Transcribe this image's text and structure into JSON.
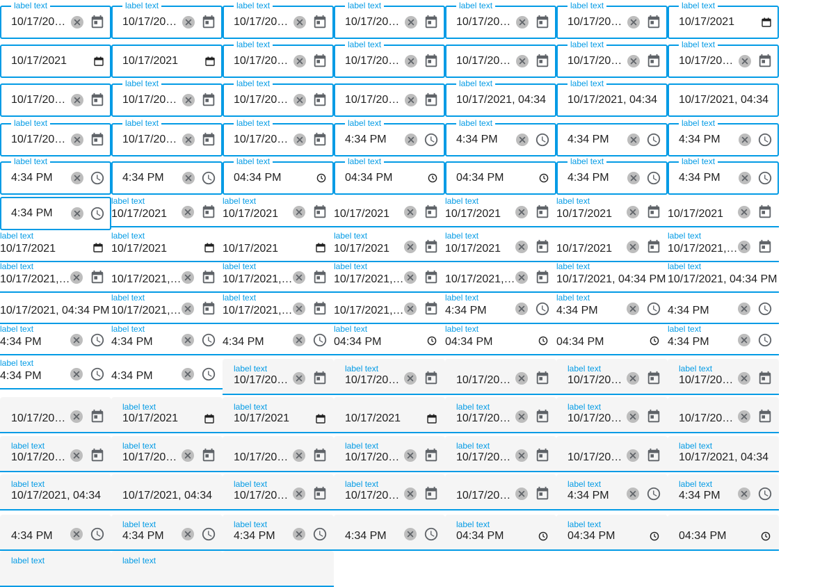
{
  "rows": [
    [
      {
        "v": "o",
        "label": "label text",
        "value": "10/17/20…",
        "icon": "calendar-icon",
        "clear": true
      },
      {
        "v": "o",
        "label": "label text",
        "value": "10/17/20…",
        "icon": "calendar-icon",
        "clear": true
      },
      {
        "v": "o",
        "label": "label text",
        "value": "10/17/20…",
        "icon": "calendar-icon",
        "clear": true
      },
      {
        "v": "o",
        "label": "label text",
        "value": "10/17/20…",
        "icon": "calendar-icon",
        "clear": true
      },
      {
        "v": "o",
        "label": "label text",
        "value": "10/17/20…",
        "icon": "calendar-icon",
        "clear": true
      },
      {
        "v": "o",
        "label": "label text",
        "value": "10/17/20…",
        "icon": "calendar-icon",
        "clear": true
      },
      {
        "v": "o",
        "label": "label text",
        "value": "10/17/2021",
        "icon": "native-calendar-icon",
        "clear": false
      }
    ],
    [
      {
        "v": "o",
        "label": "",
        "value": "10/17/2021",
        "icon": "native-calendar-icon",
        "clear": false
      },
      {
        "v": "o",
        "label": "",
        "value": "10/17/2021",
        "icon": "native-calendar-icon",
        "clear": false
      },
      {
        "v": "o",
        "label": "label text",
        "value": "10/17/20…",
        "icon": "calendar-icon",
        "clear": true
      },
      {
        "v": "o",
        "label": "label text",
        "value": "10/17/20…",
        "icon": "calendar-icon",
        "clear": true
      },
      {
        "v": "o",
        "label": "",
        "value": "10/17/20…",
        "icon": "calendar-icon",
        "clear": true
      },
      {
        "v": "o",
        "label": "label text",
        "value": "10/17/20…",
        "icon": "calendar-icon",
        "clear": true
      },
      {
        "v": "o",
        "label": "label text",
        "value": "10/17/20…",
        "icon": "calendar-icon",
        "clear": true
      }
    ],
    [
      {
        "v": "o",
        "label": "",
        "value": "10/17/20…",
        "icon": "calendar-icon",
        "clear": true
      },
      {
        "v": "o",
        "label": "label text",
        "value": "10/17/20…",
        "icon": "calendar-icon",
        "clear": true
      },
      {
        "v": "o",
        "label": "label text",
        "value": "10/17/20…",
        "icon": "calendar-icon",
        "clear": true
      },
      {
        "v": "o",
        "label": "",
        "value": "10/17/20…",
        "icon": "calendar-icon",
        "clear": true
      },
      {
        "v": "o",
        "label": "label text",
        "value": "10/17/2021, 04:34",
        "icon": "none",
        "clear": false,
        "wide": true
      },
      {
        "v": "o",
        "label": "label text",
        "value": "10/17/2021, 04:34",
        "icon": "none",
        "clear": false,
        "wide": true
      },
      {
        "v": "o",
        "label": "",
        "value": "10/17/2021, 04:34",
        "icon": "none",
        "clear": false,
        "wide": true
      }
    ],
    [
      {
        "v": "o",
        "label": "label text",
        "value": "10/17/20…",
        "icon": "calendar-icon",
        "clear": true
      },
      {
        "v": "o",
        "label": "label text",
        "value": "10/17/20…",
        "icon": "calendar-icon",
        "clear": true
      },
      {
        "v": "o",
        "label": "label text",
        "value": "10/17/20…",
        "icon": "calendar-icon",
        "clear": true
      },
      {
        "v": "o",
        "label": "label text",
        "value": "4:34 PM",
        "icon": "clock-icon",
        "clear": true
      },
      {
        "v": "o",
        "label": "label text",
        "value": "4:34 PM",
        "icon": "clock-icon",
        "clear": true
      },
      {
        "v": "o",
        "label": "",
        "value": "4:34 PM",
        "icon": "clock-icon",
        "clear": true
      },
      {
        "v": "o",
        "label": "label text",
        "value": "4:34 PM",
        "icon": "clock-icon",
        "clear": true
      }
    ],
    [
      {
        "v": "o",
        "label": "label text",
        "value": "4:34 PM",
        "icon": "clock-icon",
        "clear": true
      },
      {
        "v": "o",
        "label": "",
        "value": "4:34 PM",
        "icon": "clock-icon",
        "clear": true
      },
      {
        "v": "o",
        "label": "label text",
        "value": "04:34 PM",
        "icon": "native-clock-icon",
        "clear": false
      },
      {
        "v": "o",
        "label": "label text",
        "value": "04:34 PM",
        "icon": "native-clock-icon",
        "clear": false
      },
      {
        "v": "o",
        "label": "",
        "value": "04:34 PM",
        "icon": "native-clock-icon",
        "clear": false
      },
      {
        "v": "o",
        "label": "label text",
        "value": "4:34 PM",
        "icon": "clock-icon",
        "clear": true
      },
      {
        "v": "o",
        "label": "label text",
        "value": "4:34 PM",
        "icon": "clock-icon",
        "clear": true
      }
    ],
    [
      {
        "v": "o",
        "label": "",
        "value": "4:34 PM",
        "icon": "clock-icon",
        "clear": true
      },
      {
        "v": "s",
        "label": "label text",
        "value": "10/17/2021",
        "icon": "calendar-icon",
        "clear": true
      },
      {
        "v": "s",
        "label": "label text",
        "value": "10/17/2021",
        "icon": "calendar-icon",
        "clear": true
      },
      {
        "v": "s",
        "label": "",
        "value": "10/17/2021",
        "icon": "calendar-icon",
        "clear": true
      },
      {
        "v": "s",
        "label": "label text",
        "value": "10/17/2021",
        "icon": "calendar-icon",
        "clear": true
      },
      {
        "v": "s",
        "label": "label text",
        "value": "10/17/2021",
        "icon": "calendar-icon",
        "clear": true
      },
      {
        "v": "s",
        "label": "",
        "value": "10/17/2021",
        "icon": "calendar-icon",
        "clear": true
      }
    ],
    [
      {
        "v": "s",
        "label": "label text",
        "value": "10/17/2021",
        "icon": "native-calendar-icon",
        "clear": false
      },
      {
        "v": "s",
        "label": "label text",
        "value": "10/17/2021",
        "icon": "native-calendar-icon",
        "clear": false
      },
      {
        "v": "s",
        "label": "",
        "value": "10/17/2021",
        "icon": "native-calendar-icon",
        "clear": false
      },
      {
        "v": "s",
        "label": "label text",
        "value": "10/17/2021",
        "icon": "calendar-icon",
        "clear": true
      },
      {
        "v": "s",
        "label": "label text",
        "value": "10/17/2021",
        "icon": "calendar-icon",
        "clear": true
      },
      {
        "v": "s",
        "label": "",
        "value": "10/17/2021",
        "icon": "calendar-icon",
        "clear": true
      },
      {
        "v": "s",
        "label": "label text",
        "value": "10/17/2021,…",
        "icon": "calendar-icon",
        "clear": true
      }
    ],
    [
      {
        "v": "s",
        "label": "label text",
        "value": "10/17/2021,…",
        "icon": "calendar-icon",
        "clear": true
      },
      {
        "v": "s",
        "label": "",
        "value": "10/17/2021,…",
        "icon": "calendar-icon",
        "clear": true
      },
      {
        "v": "s",
        "label": "label text",
        "value": "10/17/2021,…",
        "icon": "calendar-icon",
        "clear": true
      },
      {
        "v": "s",
        "label": "label text",
        "value": "10/17/2021,…",
        "icon": "calendar-icon",
        "clear": true
      },
      {
        "v": "s",
        "label": "",
        "value": "10/17/2021,…",
        "icon": "calendar-icon",
        "clear": true
      },
      {
        "v": "s",
        "label": "label text",
        "value": "10/17/2021, 04:34 PM",
        "icon": "none",
        "clear": false
      },
      {
        "v": "s",
        "label": "label text",
        "value": "10/17/2021, 04:34 PM",
        "icon": "none",
        "clear": false
      }
    ],
    [
      {
        "v": "s",
        "label": "",
        "value": "10/17/2021, 04:34 PM",
        "icon": "none",
        "clear": false
      },
      {
        "v": "s",
        "label": "label text",
        "value": "10/17/2021,…",
        "icon": "calendar-icon",
        "clear": true
      },
      {
        "v": "s",
        "label": "label text",
        "value": "10/17/2021,…",
        "icon": "calendar-icon",
        "clear": true
      },
      {
        "v": "s",
        "label": "",
        "value": "10/17/2021,…",
        "icon": "calendar-icon",
        "clear": true
      },
      {
        "v": "s",
        "label": "label text",
        "value": "4:34 PM",
        "icon": "clock-icon",
        "clear": true
      },
      {
        "v": "s",
        "label": "label text",
        "value": "4:34 PM",
        "icon": "clock-icon",
        "clear": true
      },
      {
        "v": "s",
        "label": "",
        "value": "4:34 PM",
        "icon": "clock-icon",
        "clear": true
      }
    ],
    [
      {
        "v": "s",
        "label": "label text",
        "value": "4:34 PM",
        "icon": "clock-icon",
        "clear": true
      },
      {
        "v": "s",
        "label": "label text",
        "value": "4:34 PM",
        "icon": "clock-icon",
        "clear": true
      },
      {
        "v": "s",
        "label": "",
        "value": "4:34 PM",
        "icon": "clock-icon",
        "clear": true
      },
      {
        "v": "s",
        "label": "label text",
        "value": "04:34 PM",
        "icon": "native-clock-icon",
        "clear": false
      },
      {
        "v": "s",
        "label": "label text",
        "value": "04:34 PM",
        "icon": "native-clock-icon",
        "clear": false
      },
      {
        "v": "s",
        "label": "",
        "value": "04:34 PM",
        "icon": "native-clock-icon",
        "clear": false
      },
      {
        "v": "s",
        "label": "label text",
        "value": "4:34 PM",
        "icon": "clock-icon",
        "clear": true
      }
    ],
    [
      {
        "v": "s",
        "label": "label text",
        "value": "4:34 PM",
        "icon": "clock-icon",
        "clear": true
      },
      {
        "v": "s",
        "label": "",
        "value": "4:34 PM",
        "icon": "clock-icon",
        "clear": true
      },
      {
        "v": "fl",
        "label": "label text",
        "value": "10/17/20…",
        "icon": "calendar-icon",
        "clear": true
      },
      {
        "v": "fl",
        "label": "label text",
        "value": "10/17/20…",
        "icon": "calendar-icon",
        "clear": true
      },
      {
        "v": "fl",
        "label": "",
        "value": "10/17/20…",
        "icon": "calendar-icon",
        "clear": true
      },
      {
        "v": "fl",
        "label": "label text",
        "value": "10/17/20…",
        "icon": "calendar-icon",
        "clear": true
      },
      {
        "v": "fl",
        "label": "label text",
        "value": "10/17/20…",
        "icon": "calendar-icon",
        "clear": true
      }
    ],
    [
      {
        "v": "fl",
        "label": "",
        "value": "10/17/20…",
        "icon": "calendar-icon",
        "clear": true
      },
      {
        "v": "fl",
        "label": "label text",
        "value": "10/17/2021",
        "icon": "native-calendar-icon",
        "clear": false
      },
      {
        "v": "fl",
        "label": "label text",
        "value": "10/17/2021",
        "icon": "native-calendar-icon",
        "clear": false
      },
      {
        "v": "fl",
        "label": "",
        "value": "10/17/2021",
        "icon": "native-calendar-icon",
        "clear": false
      },
      {
        "v": "fl",
        "label": "label text",
        "value": "10/17/20…",
        "icon": "calendar-icon",
        "clear": true
      },
      {
        "v": "fl",
        "label": "label text",
        "value": "10/17/20…",
        "icon": "calendar-icon",
        "clear": true
      },
      {
        "v": "fl",
        "label": "",
        "value": "10/17/20…",
        "icon": "calendar-icon",
        "clear": true
      }
    ],
    [
      {
        "v": "fl",
        "label": "label text",
        "value": "10/17/20…",
        "icon": "calendar-icon",
        "clear": true
      },
      {
        "v": "fl",
        "label": "label text",
        "value": "10/17/20…",
        "icon": "calendar-icon",
        "clear": true
      },
      {
        "v": "fl",
        "label": "",
        "value": "10/17/20…",
        "icon": "calendar-icon",
        "clear": true
      },
      {
        "v": "fl",
        "label": "label text",
        "value": "10/17/20…",
        "icon": "calendar-icon",
        "clear": true
      },
      {
        "v": "fl",
        "label": "label text",
        "value": "10/17/20…",
        "icon": "calendar-icon",
        "clear": true
      },
      {
        "v": "fl",
        "label": "",
        "value": "10/17/20…",
        "icon": "calendar-icon",
        "clear": true
      },
      {
        "v": "fl",
        "label": "label text",
        "value": "10/17/2021, 04:34",
        "icon": "none",
        "clear": false
      }
    ],
    [
      {
        "v": "fl",
        "label": "label text",
        "value": "10/17/2021, 04:34",
        "icon": "none",
        "clear": false
      },
      {
        "v": "fl",
        "label": "",
        "value": "10/17/2021, 04:34",
        "icon": "none",
        "clear": false
      },
      {
        "v": "fl",
        "label": "label text",
        "value": "10/17/20…",
        "icon": "calendar-icon",
        "clear": true
      },
      {
        "v": "fl",
        "label": "label text",
        "value": "10/17/20…",
        "icon": "calendar-icon",
        "clear": true
      },
      {
        "v": "fl",
        "label": "",
        "value": "10/17/20…",
        "icon": "calendar-icon",
        "clear": true
      },
      {
        "v": "fl",
        "label": "label text",
        "value": "4:34 PM",
        "icon": "clock-icon",
        "clear": true
      },
      {
        "v": "fl",
        "label": "label text",
        "value": "4:34 PM",
        "icon": "clock-icon",
        "clear": true
      }
    ],
    [
      {
        "v": "fl",
        "label": "",
        "value": "4:34 PM",
        "icon": "clock-icon",
        "clear": true
      },
      {
        "v": "fl",
        "label": "label text",
        "value": "4:34 PM",
        "icon": "clock-icon",
        "clear": true
      },
      {
        "v": "fl",
        "label": "label text",
        "value": "4:34 PM",
        "icon": "clock-icon",
        "clear": true
      },
      {
        "v": "fl",
        "label": "",
        "value": "4:34 PM",
        "icon": "clock-icon",
        "clear": true
      },
      {
        "v": "fl",
        "label": "label text",
        "value": "04:34 PM",
        "icon": "native-clock-icon",
        "clear": false
      },
      {
        "v": "fl",
        "label": "label text",
        "value": "04:34 PM",
        "icon": "native-clock-icon",
        "clear": false
      },
      {
        "v": "fl",
        "label": "",
        "value": "04:34 PM",
        "icon": "native-clock-icon",
        "clear": false
      }
    ],
    [
      {
        "v": "fl",
        "label": "label text",
        "value": "",
        "icon": "none",
        "clear": false
      },
      {
        "v": "fl",
        "label": "label text",
        "value": "",
        "icon": "none",
        "clear": false
      },
      {
        "v": "fl",
        "label": "",
        "value": "",
        "icon": "none",
        "clear": false
      }
    ]
  ],
  "colors": {
    "accent": "#039be5",
    "icon": "#5f6368",
    "clear_bg": "#bdbdbd",
    "fill_bg": "#f5f5f5"
  }
}
